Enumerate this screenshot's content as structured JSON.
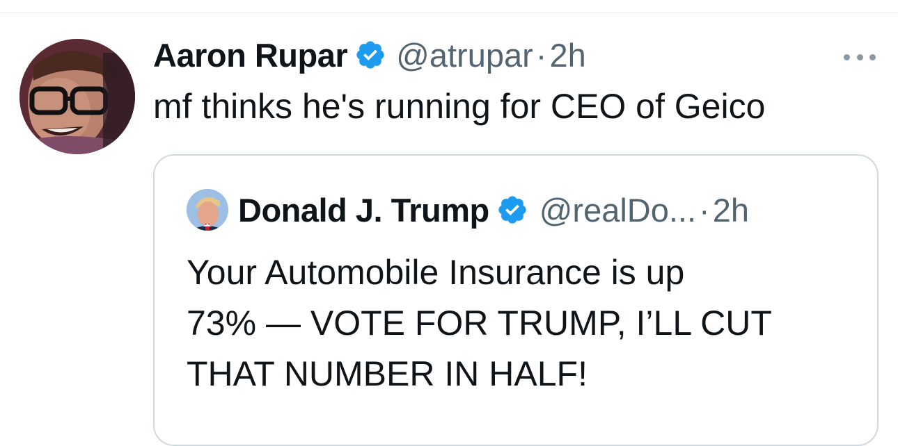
{
  "tweet": {
    "author_name": "Aaron Rupar",
    "handle": "@atrupar",
    "separator": "·",
    "time": "2h",
    "text": "mf thinks he's running for CEO of Geico",
    "verified_icon": "verified-badge-icon",
    "more_icon": "more-options-icon"
  },
  "quoted_tweet": {
    "author_name": "Donald J. Trump",
    "handle": "@realDo...",
    "separator": "·",
    "time": "2h",
    "text": "Your Automobile Insurance is up\n73% — VOTE FOR TRUMP, I’LL CUT\nTHAT NUMBER IN HALF!",
    "verified_icon": "verified-badge-icon"
  },
  "colors": {
    "primary_text": "#0f1419",
    "secondary_text": "#536471",
    "verified_blue": "#1d9bf0",
    "border": "#cfd9de"
  }
}
